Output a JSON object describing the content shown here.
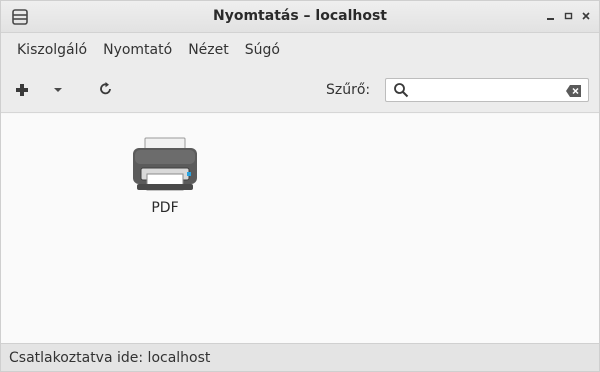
{
  "window": {
    "title": "Nyomtatás – localhost",
    "icons": {
      "app": "printer-small-icon",
      "minimize": "minimize-icon",
      "maximize": "maximize-icon",
      "close": "close-icon"
    }
  },
  "menubar": {
    "items": [
      {
        "label": "Kiszolgáló"
      },
      {
        "label": "Nyomtató"
      },
      {
        "label": "Nézet"
      },
      {
        "label": "Súgó"
      }
    ]
  },
  "toolbar": {
    "icons": {
      "add": "add-icon",
      "dropdown": "chevron-down-icon",
      "refresh": "refresh-icon"
    },
    "filter_label": "Szűrő:",
    "filter_value": "",
    "filter_placeholder": ""
  },
  "content": {
    "printers": [
      {
        "name": "PDF",
        "icon": "printer-icon"
      }
    ]
  },
  "statusbar": {
    "text": "Csatlakoztatva ide: localhost"
  },
  "colors": {
    "titlebar": "#e6e6e6",
    "menubar": "#ececec",
    "content_bg": "#fafafa",
    "statusbar": "#e4e4e4"
  }
}
